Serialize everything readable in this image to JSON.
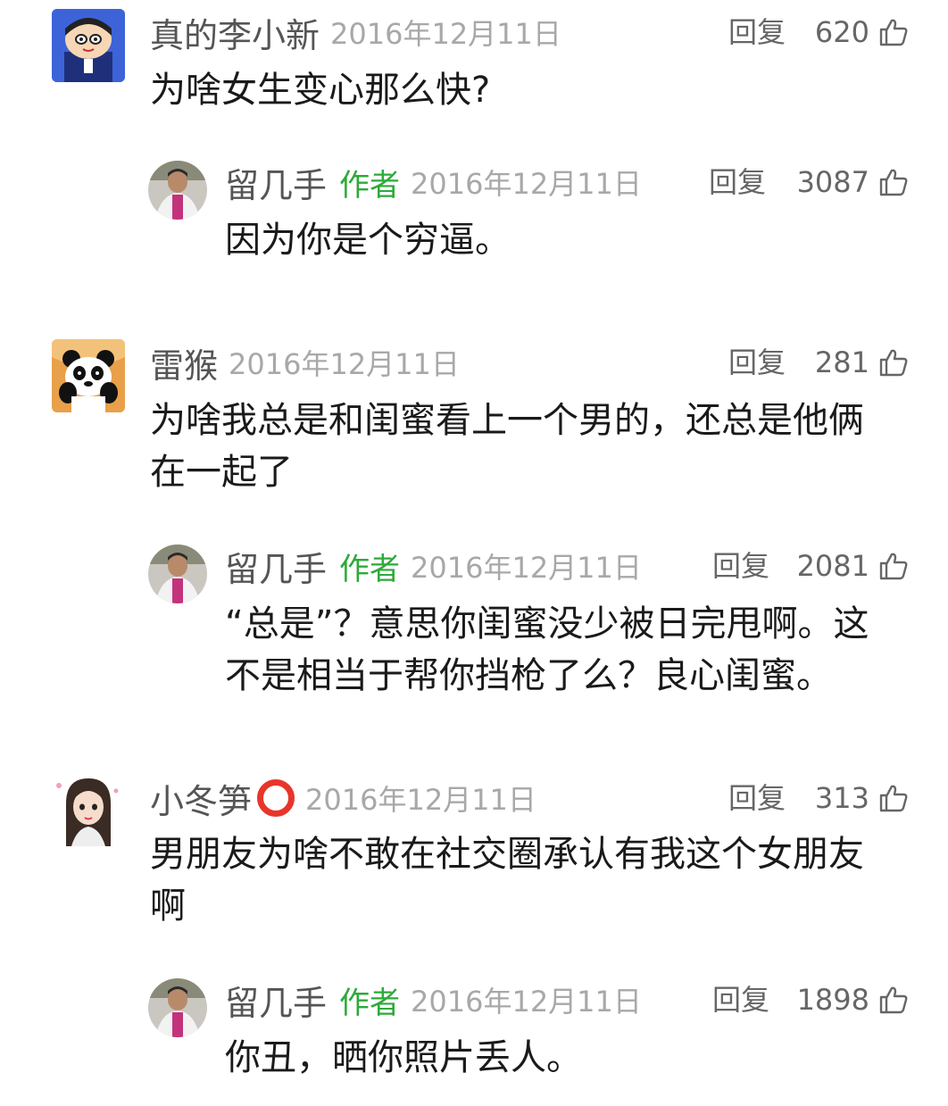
{
  "comments": [
    {
      "username": "真的李小新",
      "date": "2016年12月11日",
      "reply_label": "回复",
      "likes": "620",
      "text": "为啥女生变心那么快?",
      "reply": {
        "username": "留几手",
        "author_tag": "作者",
        "date": "2016年12月11日",
        "reply_label": "回复",
        "likes": "3087",
        "text": "因为你是个穷逼。"
      }
    },
    {
      "username": "雷猴",
      "date": "2016年12月11日",
      "reply_label": "回复",
      "likes": "281",
      "text_lines": [
        "为啥我总是和闺蜜看上一个男的，还总是他俩",
        "在一起了"
      ],
      "reply": {
        "username": "留几手",
        "author_tag": "作者",
        "date": "2016年12月11日",
        "reply_label": "回复",
        "likes": "2081",
        "text_lines": [
          "“总是”？意思你闺蜜没少被日完甩啊。这",
          "不是相当于帮你挡枪了么？良心闺蜜。"
        ]
      }
    },
    {
      "username": "小冬笋",
      "date": "2016年12月11日",
      "reply_label": "回复",
      "likes": "313",
      "text_lines": [
        "男朋友为啥不敢在社交圈承认有我这个女朋友",
        "啊"
      ],
      "reply": {
        "username": "留几手",
        "author_tag": "作者",
        "date": "2016年12月11日",
        "reply_label": "回复",
        "likes": "1898",
        "text": "你丑，晒你照片丢人。"
      }
    }
  ],
  "icons": {
    "like": "thumbs-up-icon",
    "emoji": "red-circle-icon"
  },
  "colors": {
    "author_tag": "#2daa3a",
    "emoji_ring": "#e8352a"
  }
}
